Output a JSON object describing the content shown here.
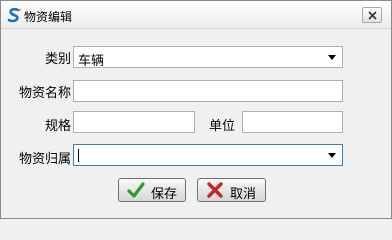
{
  "window": {
    "title": "物资编辑"
  },
  "icons": {
    "app": "app-s-logo-icon",
    "close": "close-icon",
    "save": "checkmark-icon",
    "cancel": "x-icon",
    "dropdown": "chevron-down-icon"
  },
  "colors": {
    "save_icon": "#2a9d2a",
    "cancel_icon": "#c0262b",
    "app_icon": "#1b6ec2"
  },
  "form": {
    "category": {
      "label": "类别",
      "value": "车辆"
    },
    "material_name": {
      "label": "物资名称",
      "value": ""
    },
    "spec": {
      "label": "规格",
      "value": ""
    },
    "unit": {
      "label": "单位",
      "value": ""
    },
    "ownership": {
      "label": "物资归属",
      "value": ""
    }
  },
  "buttons": {
    "save": "保存",
    "cancel": "取消"
  }
}
